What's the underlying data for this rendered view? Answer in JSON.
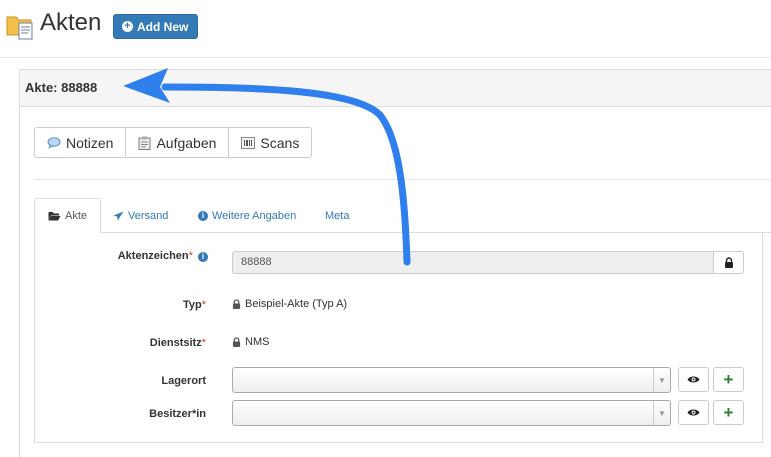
{
  "header": {
    "title": "Akten",
    "add_new_label": "Add New"
  },
  "panel": {
    "heading": "Akte: 88888"
  },
  "action_buttons": [
    {
      "label": "Notizen",
      "icon": "speech-bubble-icon"
    },
    {
      "label": "Aufgaben",
      "icon": "clipboard-icon"
    },
    {
      "label": "Scans",
      "icon": "barcode-icon"
    }
  ],
  "tabs": [
    {
      "label": "Akte",
      "icon": "folder-open-icon",
      "active": true
    },
    {
      "label": "Versand",
      "icon": "paper-plane-icon",
      "active": false
    },
    {
      "label": "Weitere Angaben",
      "icon": "info-circle-icon",
      "active": false
    },
    {
      "label": "Meta",
      "icon": "",
      "active": false
    }
  ],
  "form": {
    "aktenzeichen": {
      "label": "Aktenzeichen",
      "required": "*",
      "value": "88888"
    },
    "typ": {
      "label": "Typ",
      "required": "*",
      "value": "Beispiel-Akte (Typ A)"
    },
    "dienstsitz": {
      "label": "Dienstsitz",
      "required": "*",
      "value": "NMS"
    },
    "lagerort": {
      "label": "Lagerort",
      "value": ""
    },
    "besitzer": {
      "label": "Besitzer*in",
      "value": ""
    }
  },
  "colors": {
    "primary": "#337ab7",
    "annotation_arrow": "#2f80ed",
    "add_green": "#2e7d32"
  }
}
